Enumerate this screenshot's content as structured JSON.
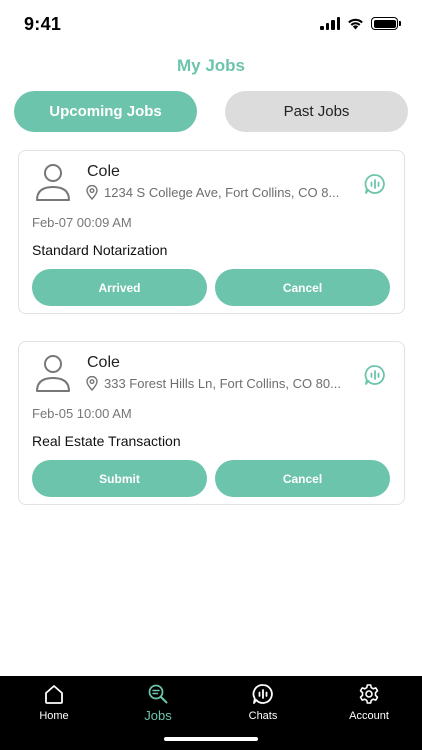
{
  "status_bar": {
    "time": "9:41"
  },
  "header": {
    "title": "My Jobs"
  },
  "tabs": [
    {
      "label": "Upcoming Jobs",
      "active": true
    },
    {
      "label": "Past Jobs",
      "active": false
    }
  ],
  "jobs": [
    {
      "client_name": "Cole",
      "address": "1234 S College Ave, Fort Collins, CO 8...",
      "date": "Feb-07 00:09 AM",
      "service": "Standard Notarization",
      "primary_action": "Arrived",
      "secondary_action": "Cancel"
    },
    {
      "client_name": "Cole",
      "address": "333 Forest Hills Ln, Fort Collins, CO 80...",
      "date": "Feb-05 10:00 AM",
      "service": "Real Estate Transaction",
      "primary_action": "Submit",
      "secondary_action": "Cancel"
    }
  ],
  "bottom_nav": [
    {
      "label": "Home",
      "icon": "home-icon",
      "active": false
    },
    {
      "label": "Jobs",
      "icon": "search-document-icon",
      "active": true
    },
    {
      "label": "Chats",
      "icon": "chat-icon",
      "active": false
    },
    {
      "label": "Account",
      "icon": "gear-icon",
      "active": false
    }
  ],
  "colors": {
    "accent": "#6cc4ac",
    "tab_inactive": "#dcdcdc",
    "nav_background": "#000000"
  }
}
